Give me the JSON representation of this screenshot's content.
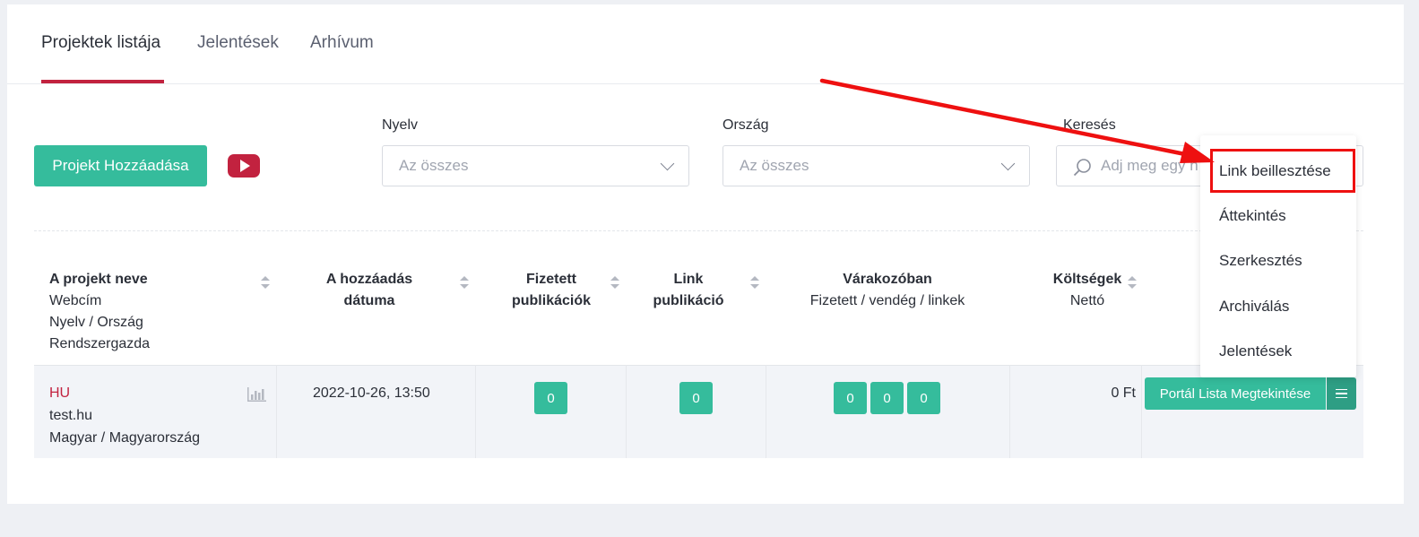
{
  "tabs": [
    {
      "label": "Projektek listája",
      "active": true
    },
    {
      "label": "Jelentések",
      "active": false
    },
    {
      "label": "Arhívum",
      "active": false
    }
  ],
  "toolbar": {
    "add_project_label": "Projekt Hozzáadása",
    "youtube_icon": "youtube-icon"
  },
  "filters": {
    "language": {
      "label": "Nyelv",
      "value": "Az összes"
    },
    "country": {
      "label": "Ország",
      "value": "Az összes"
    },
    "search": {
      "label": "Keresés",
      "placeholder": "Adj meg egy n"
    }
  },
  "table": {
    "headers": {
      "project": {
        "title": "A projekt neve",
        "sub1": "Webcím",
        "sub2": "Nyelv / Ország",
        "sub3": "Rendszergazda"
      },
      "date": {
        "line1": "A hozzáadás",
        "line2": "dátuma"
      },
      "paid": {
        "line1": "Fizetett",
        "line2": "publikációk"
      },
      "link": {
        "line1": "Link",
        "line2": "publikáció"
      },
      "waiting": {
        "title": "Várakozóban",
        "sub": "Fizetett / vendég / linkek"
      },
      "costs": {
        "title": "Költségek",
        "sub": "Nettó"
      }
    },
    "rows": [
      {
        "code": "HU",
        "url": "test.hu",
        "lang_country": "Magyar / Magyarország",
        "date": "2022-10-26, 13:50",
        "paid": "0",
        "link": "0",
        "waiting_paid": "0",
        "waiting_guest": "0",
        "waiting_links": "0",
        "cost": "0 Ft",
        "portal_button": "Portál Lista Megtekintése"
      }
    ]
  },
  "dropdown": {
    "items": [
      {
        "label": "Link beillesztése",
        "highlighted": true
      },
      {
        "label": "Áttekintés"
      },
      {
        "label": "Szerkesztés"
      },
      {
        "label": "Archiválás"
      },
      {
        "label": "Jelentések"
      }
    ]
  },
  "colors": {
    "accent": "#35bc9c",
    "brand": "#c2223f",
    "annotation": "#ee1010"
  }
}
